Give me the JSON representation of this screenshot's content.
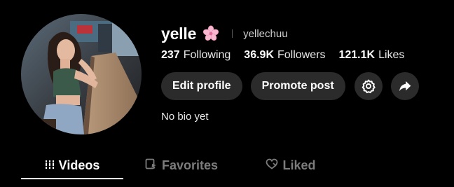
{
  "profile": {
    "display_name": "yelle",
    "name_emoji_icon": "cherry-blossom-icon",
    "username": "yellechuu",
    "bio": "No bio yet"
  },
  "stats": {
    "following_count": "237",
    "following_label": "Following",
    "followers_count": "36.9K",
    "followers_label": "Followers",
    "likes_count": "121.1K",
    "likes_label": "Likes"
  },
  "actions": {
    "edit_profile_label": "Edit profile",
    "promote_post_label": "Promote post",
    "settings_icon": "gear-icon",
    "share_icon": "share-arrow-icon"
  },
  "tabs": [
    {
      "label": "Videos",
      "icon": "grid-lines-icon",
      "active": true
    },
    {
      "label": "Favorites",
      "icon": "bookmark-icon",
      "active": false
    },
    {
      "label": "Liked",
      "icon": "heart-icon",
      "active": false
    }
  ],
  "colors": {
    "background": "#000000",
    "button_bg": "#2b2b2b",
    "inactive_tab": "#7c7c7c",
    "active_tab": "#ffffff"
  }
}
